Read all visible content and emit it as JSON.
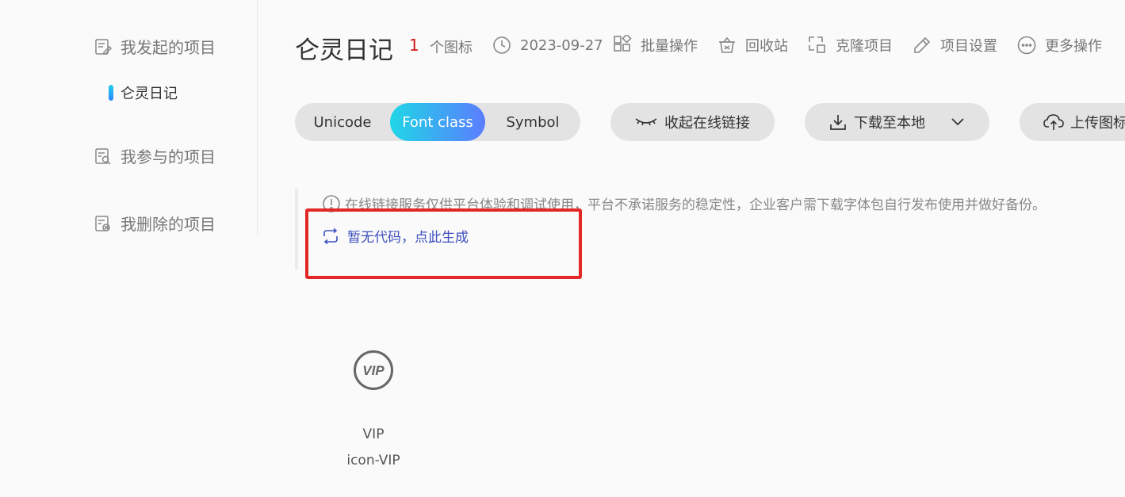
{
  "sidebar": {
    "items": [
      {
        "label": "我发起的项目",
        "icon": "edit-doc-icon"
      },
      {
        "label": "我参与的项目",
        "icon": "search-doc-icon"
      },
      {
        "label": "我删除的项目",
        "icon": "deleted-doc-icon"
      }
    ],
    "sub_item": {
      "label": "仑灵日记"
    }
  },
  "header": {
    "title": "仑灵日记",
    "icon_count": "1",
    "icon_count_label": "个图标",
    "date": "2023-09-27",
    "actions": {
      "batch": "批量操作",
      "recycle": "回收站",
      "clone": "克隆项目",
      "settings": "项目设置",
      "more": "更多操作"
    }
  },
  "toolbar": {
    "tabs": [
      "Unicode",
      "Font class",
      "Symbol"
    ],
    "active_tab": "Font class",
    "collapse_link": "收起在线链接",
    "download": "下载至本地",
    "upload": "上传图标"
  },
  "notice": {
    "text": "在线链接服务仅供平台体验和调试使用，平台不承诺服务的稳定性，企业客户需下载字体包自行发布使用并做好备份。",
    "generate_link": "暂无代码，点此生成"
  },
  "icons": [
    {
      "glyph": "VIP",
      "name": "VIP",
      "class_name": "icon-VIP"
    }
  ],
  "colors": {
    "accent_gradient_start": "#1fd6e6",
    "accent_gradient_end": "#5b7dff",
    "count_red": "#d01616",
    "link_blue": "#3d4fbf",
    "highlight_red": "#e32626"
  }
}
